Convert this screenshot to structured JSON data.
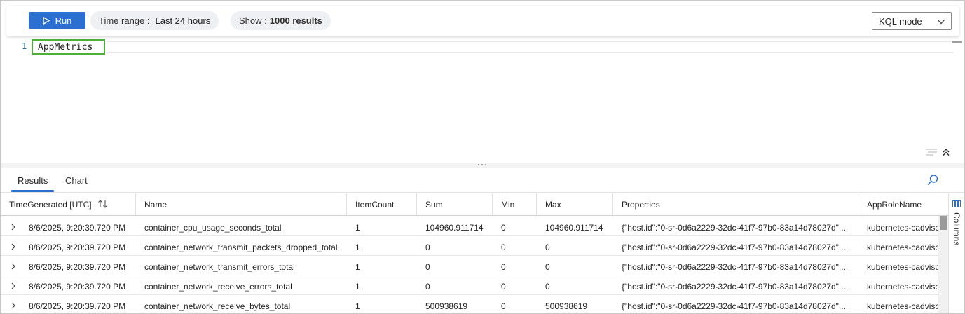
{
  "toolbar": {
    "run_label": "Run",
    "time_range_label": "Time range :",
    "time_range_value": "Last 24 hours",
    "show_label": "Show :",
    "show_value": "1000 results",
    "mode_value": "KQL mode"
  },
  "editor": {
    "line_number": "1",
    "query": "AppMetrics"
  },
  "splitter": {
    "grip": "···"
  },
  "results": {
    "tabs": [
      "Results",
      "Chart"
    ],
    "columns_label": "Columns",
    "headers": [
      "TimeGenerated [UTC]",
      "Name",
      "ItemCount",
      "Sum",
      "Min",
      "Max",
      "Properties",
      "AppRoleName"
    ],
    "rows": [
      [
        "8/6/2025, 9:20:39.720 PM",
        "container_cpu_usage_seconds_total",
        "1",
        "104960.911714",
        "0",
        "104960.911714",
        "{\"host.id\":\"0-sr-0d6a2229-32dc-41f7-97b0-83a14d78027d\",...",
        "kubernetes-cadvisor"
      ],
      [
        "8/6/2025, 9:20:39.720 PM",
        "container_network_transmit_packets_dropped_total",
        "1",
        "0",
        "0",
        "0",
        "{\"host.id\":\"0-sr-0d6a2229-32dc-41f7-97b0-83a14d78027d\",...",
        "kubernetes-cadvisor"
      ],
      [
        "8/6/2025, 9:20:39.720 PM",
        "container_network_transmit_errors_total",
        "1",
        "0",
        "0",
        "0",
        "{\"host.id\":\"0-sr-0d6a2229-32dc-41f7-97b0-83a14d78027d\",...",
        "kubernetes-cadvisor"
      ],
      [
        "8/6/2025, 9:20:39.720 PM",
        "container_network_receive_errors_total",
        "1",
        "0",
        "0",
        "0",
        "{\"host.id\":\"0-sr-0d6a2229-32dc-41f7-97b0-83a14d78027d\",...",
        "kubernetes-cadvisor"
      ],
      [
        "8/6/2025, 9:20:39.720 PM",
        "container_network_receive_bytes_total",
        "1",
        "500938619",
        "0",
        "500938619",
        "{\"host.id\":\"0-sr-0d6a2229-32dc-41f7-97b0-83a14d78027d\",...",
        "kubernetes-cadvisor"
      ]
    ]
  },
  "colors": {
    "accent": "#2b6fd1",
    "query_highlight": "#4caf37"
  },
  "icons": [
    "play-icon",
    "chevron-down-icon",
    "wrap-lines-icon",
    "collapse-up-icon",
    "search-icon",
    "sort-icon",
    "expand-row-icon",
    "columns-icon"
  ]
}
